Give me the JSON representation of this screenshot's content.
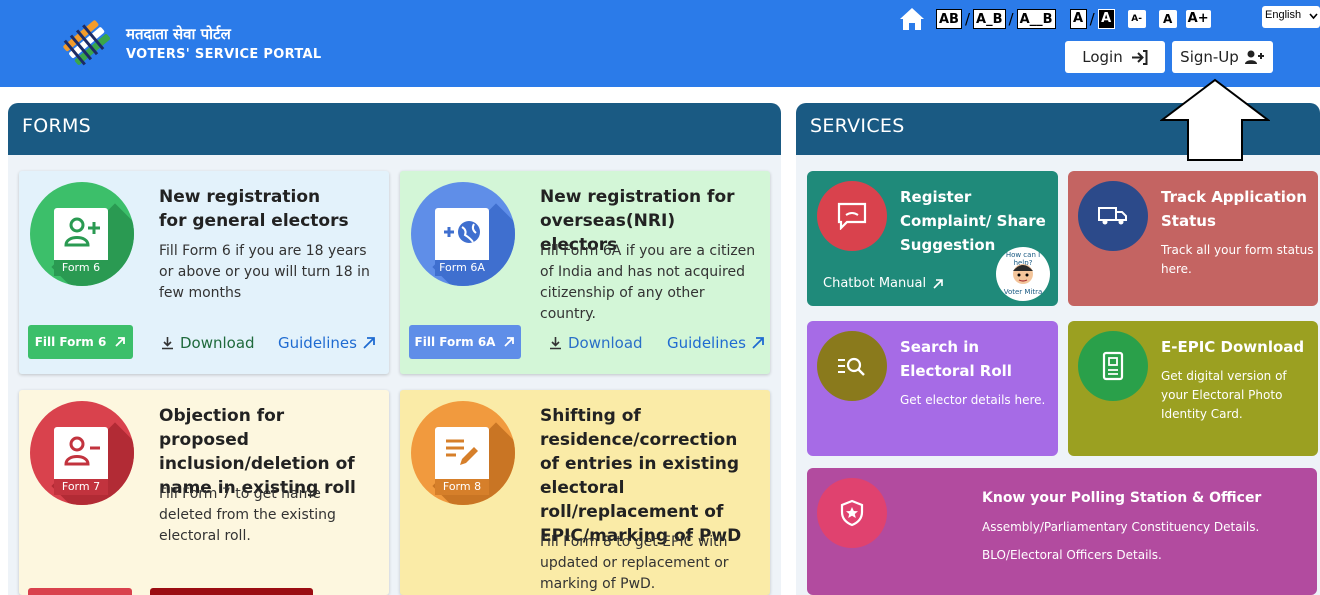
{
  "header": {
    "hindi_title": "मतदाता सेवा पोर्टल",
    "title": "VOTERS' SERVICE PORTAL",
    "accessibility": {
      "contrast_1": "AB",
      "contrast_2": "A_B",
      "contrast_3": "A__B",
      "light_a": "A",
      "dark_a": "A",
      "size_small": "A-",
      "size_normal": "A",
      "size_large": "A+"
    },
    "language": "English",
    "login_label": "Login",
    "signup_label": "Sign-Up"
  },
  "forms": {
    "heading": "FORMS",
    "cards": [
      {
        "badge": "Form 6",
        "title": "New registration for general electors",
        "description": "Fill Form 6 if you are 18 years or above or you will turn 18 in few months",
        "fill_label": "Fill Form 6",
        "download_label": "Download",
        "guidelines_label": "Guidelines"
      },
      {
        "badge": "Form 6A",
        "title": "New registration for overseas(NRI) electors",
        "description": "Fill Form 6A if you are a citizen of India and has not acquired citizenship of any other country.",
        "fill_label": "Fill Form 6A",
        "download_label": "Download",
        "guidelines_label": "Guidelines"
      },
      {
        "badge": "Form 7",
        "title": "Objection for proposed inclusion/deletion of name in existing roll",
        "description": "Fill Form 7 to get name deleted from the existing electoral roll."
      },
      {
        "badge": "Form 8",
        "title": "Shifting of residence/correction of entries in existing electoral roll/replacement of EPIC/marking of PwD",
        "description": "Fill Form 8 to get EPIC with updated or replacement or marking of PwD."
      }
    ]
  },
  "services": {
    "heading": "SERVICES",
    "cards": [
      {
        "title": "Register Complaint/ Share Suggestion",
        "link": "Chatbot Manual",
        "badge_top": "How can I help?",
        "badge_bottom": "Voter Mitra"
      },
      {
        "title": "Track Application Status",
        "description": "Track all your form status here."
      },
      {
        "title": "Search in Electoral Roll",
        "description": "Get elector details here."
      },
      {
        "title": "E-EPIC Download",
        "description": "Get digital version of your Electoral Photo Identity Card."
      },
      {
        "title": "Know your Polling Station & Officer",
        "line1": "Assembly/Parliamentary Constituency Details.",
        "line2": "BLO/Electoral Officers Details."
      }
    ]
  },
  "colors": {
    "header_blue": "#2b7be9",
    "panel_head": "#1a5a83",
    "form6_green": "#3cbf6a",
    "form6a_blue": "#5f8ee8",
    "form7_red": "#d9424d",
    "form8_orange": "#f19a3e",
    "complaint_teal": "#1f8a7a",
    "track_rose": "#c46462",
    "search_purple": "#a66be6",
    "epic_olive": "#9ba021",
    "polling_magenta": "#b24b9f"
  }
}
